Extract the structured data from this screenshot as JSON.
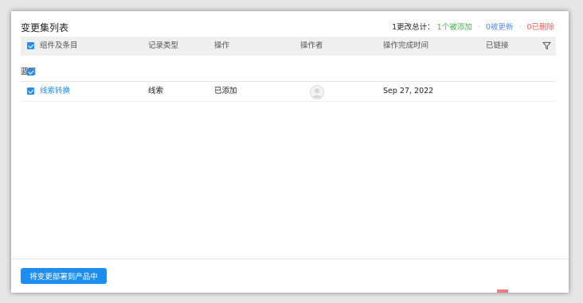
{
  "panel": {
    "title": "变更集列表",
    "summary": {
      "total": "1更改总计：",
      "added": "1个被添加",
      "updated": "0被更新",
      "deleted": "0已删除"
    }
  },
  "table": {
    "headers": {
      "component": "组件及条目",
      "record_type": "记录类型",
      "operation": "操作",
      "operator": "操作者",
      "completed_time": "操作完成时间",
      "linked": "已链接"
    },
    "group": {
      "label": "蓝图"
    },
    "rows": [
      {
        "component": "线索转换",
        "record_type": "线索",
        "operation": "已添加",
        "operator_icon": "user-avatar-icon",
        "completed_time": "Sep 27, 2022",
        "linked": ""
      }
    ]
  },
  "footer": {
    "deploy_button": "将变更部署到产品中"
  },
  "colors": {
    "accent": "#2b8de8",
    "added": "#4caf50",
    "updated": "#5b8def",
    "deleted": "#f05a5a"
  }
}
